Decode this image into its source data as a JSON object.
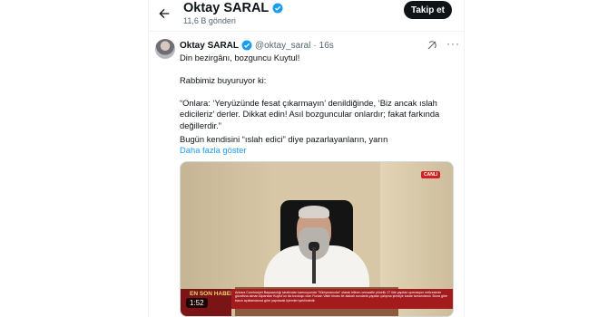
{
  "header": {
    "back_icon": "arrow-left-icon",
    "name": "Oktay SARAL",
    "verified_icon": "verified-badge-icon",
    "post_count": "11,6 B gönderi",
    "follow_label": "Takip et"
  },
  "tweet": {
    "author_name": "Oktay SARAL",
    "handle": "@oktay_saral",
    "separator": "·",
    "time": "16s",
    "share_icon": "grok-icon",
    "more_icon": "more-icon",
    "more_glyph": "···",
    "paragraphs": [
      "Din bezirgânı, bozguncu Kuytul!",
      "Rabbimiz buyuruyor ki:",
      "“Onlara: ‘Yeryüzünde fesat çıkarmayın’ denildiğinde, ‘Biz ancak ıslah edicileriz’ derler. Dikkat edin! Asıl bozguncular onlardır; fakat farkında değillerdir.”",
      "Bugün kendisini “ıslah edici” diye pazarlayanların, yarın"
    ],
    "show_more": "Daha fazla göster"
  },
  "video": {
    "live_badge": "CANLI",
    "banner_title": "EN SON HABER",
    "banner_text": "Ankara Cumhuriyet Başsavcılığı tarafından kamuoyunda \"Süleymancılar\" olarak bilinen cemaatle yönelik 17 ilde yapılan operasyon neticesinde gözaltına alınan Alparslan Kuytul'un da kuruluşu olan Furkan Vakfı binası ile alakalı sorularla yapılan çalışma şimdiye kadar tamamlandı. Buna göre basın açıklamasına göre yapılacak işlemleri şeklindedir.",
    "duration": "1:52"
  },
  "colors": {
    "accent": "#1d9bf0",
    "text": "#0f1419",
    "muted": "#536471"
  }
}
